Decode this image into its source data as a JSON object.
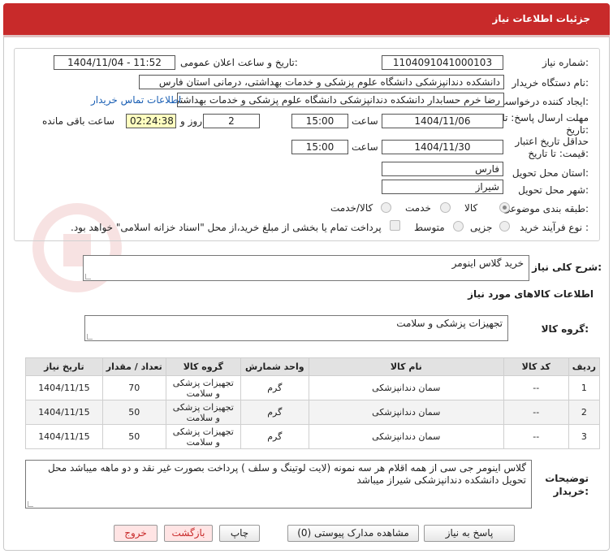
{
  "header": {
    "title": "جزئیات اطلاعات نیاز"
  },
  "form": {
    "need_number_label": "شماره نیاز:",
    "need_number": "1104091041000103",
    "announce_label": "تاریخ و ساعت اعلان عمومی:",
    "announce_value": "1404/11/04 - 11:52",
    "buyer_org_label": "نام دستگاه خریدار:",
    "buyer_org": "دانشکده دندانپزشکی دانشگاه علوم پزشکی و خدمات بهداشتی، درمانی استان فارس",
    "requester_label": "ایجاد کننده درخواست:",
    "requester": "رضا خرم حسابدار دانشکده دندانپزشکی دانشگاه علوم پزشکی و خدمات بهداشتی",
    "contact_link": "اطلاعات تماس خریدار",
    "deadline_label_1": "مهلت ارسال پاسخ: تا",
    "deadline_label_2": "تاریخ:",
    "deadline_date": "1404/11/06",
    "time_label": "ساعت",
    "deadline_time": "15:00",
    "days_value": "2",
    "days_label": "روز و",
    "remaining_time": "02:24:38",
    "remaining_label": "ساعت باقی مانده",
    "validity_label_1": "حداقل تاریخ اعتبار",
    "validity_label_2": "قیمت: تا تاریخ:",
    "validity_date": "1404/11/30",
    "validity_time": "15:00",
    "province_label": "استان محل تحویل:",
    "province": "فارس",
    "city_label": "شهر محل تحویل:",
    "city": "شیراز",
    "category_label": "طبقه بندی موضوعی:",
    "category_options": [
      "کالا",
      "خدمت",
      "کالا/خدمت"
    ],
    "process_label": "نوع فرآیند خرید :",
    "process_options": [
      "جزیی",
      "متوسط"
    ],
    "payment_note": "پرداخت تمام یا بخشی از مبلغ خرید،از محل \"اسناد خزانه اسلامی\" خواهد بود."
  },
  "summary": {
    "label": "شرح کلی نیاز:",
    "value": "خرید گلاس اینومر"
  },
  "goods_info_title": "اطلاعات کالاهای مورد نیاز",
  "goods_group": {
    "label": "گروه کالا:",
    "value": "تجهیزات پزشکی و سلامت"
  },
  "table": {
    "headers": [
      "ردیف",
      "کد کالا",
      "نام کالا",
      "واحد شمارش",
      "گروه کالا",
      "تعداد / مقدار",
      "تاریخ نیاز"
    ],
    "rows": [
      [
        "1",
        "--",
        "سمان دندانپزشکی",
        "گرم",
        "تجهیزات پزشکی و سلامت",
        "70",
        "1404/11/15"
      ],
      [
        "2",
        "--",
        "سمان دندانپزشکی",
        "گرم",
        "تجهیزات پزشکی و سلامت",
        "50",
        "1404/11/15"
      ],
      [
        "3",
        "--",
        "سمان دندانپزشکی",
        "گرم",
        "تجهیزات پزشکی و سلامت",
        "50",
        "1404/11/15"
      ]
    ]
  },
  "buyer_notes": {
    "label_1": "توضیحات",
    "label_2": "خریدار:",
    "value": "گلاس اینومر جی سی از همه اقلام  هر سه نمونه (لایت لوتینگ و سلف ) پرداخت بصورت غیر نقد و دو ماهه میباشد  محل تحویل دانشکده دندانپزشکی شیراز میباشد"
  },
  "buttons": {
    "reply": "پاسخ به نیاز",
    "attachments": "مشاهده مدارک پیوستی (0)",
    "print": "چاپ",
    "back": "بازگشت",
    "exit": "خروج"
  },
  "colors": {
    "header": "#c82a2a",
    "link": "#1a5fb4"
  }
}
